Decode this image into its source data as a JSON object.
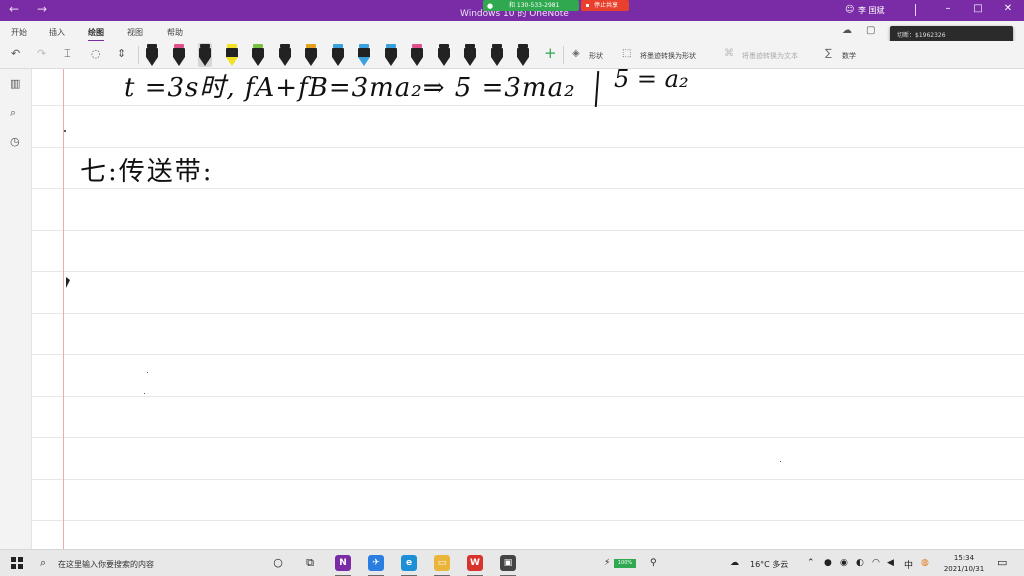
{
  "titlebar": {
    "title": "Windows 10 的 OneNote",
    "share_phone": "和 130-533-2981",
    "stop_share": "停止共享",
    "user": "李 国斌",
    "back_icon": "←",
    "forward_icon": "→"
  },
  "menu": {
    "tabs": [
      "开始",
      "插入",
      "绘图",
      "视图",
      "帮助"
    ],
    "active": "绘图"
  },
  "notification": {
    "text": "切断：$1962326"
  },
  "ribbon": {
    "shapes_label": "形状",
    "ink_to_shape": "将墨迹转换为形状",
    "ink_to_text": "将墨迹转换为文本",
    "math_label": "数学",
    "pens": [
      {
        "cap": "#222222",
        "tip": "#222222"
      },
      {
        "cap": "#e0508a",
        "tip": "#222222"
      },
      {
        "cap": "#222222",
        "tip": "#222222"
      },
      {
        "cap": "#f0e020",
        "tip": "#f0e020"
      },
      {
        "cap": "#7cc242",
        "tip": "#222222"
      },
      {
        "cap": "#222222",
        "tip": "#222222"
      },
      {
        "cap": "#e6a020",
        "tip": "#222222"
      },
      {
        "cap": "#3aa0e0",
        "tip": "#222222"
      },
      {
        "cap": "#3aa0e0",
        "tip": "#3aa0e0"
      },
      {
        "cap": "#3aa0e0",
        "tip": "#222222"
      },
      {
        "cap": "#e0508a",
        "tip": "#222222"
      },
      {
        "cap": "#222222",
        "tip": "#222222"
      },
      {
        "cap": "#222222",
        "tip": "#222222"
      },
      {
        "cap": "#222222",
        "tip": "#222222"
      },
      {
        "cap": "#222222",
        "tip": "#222222"
      }
    ]
  },
  "canvas": {
    "line1": "t =3s时, fA+fB=3ma₂⇒   5 =3ma₂",
    "line1_tail": "5 = a₂",
    "line2": "七:传送带:"
  },
  "taskbar": {
    "search_placeholder": "在这里输入你要搜索的内容",
    "battery": "100%",
    "weather": "16°C 多云",
    "ime": "中",
    "time": "15:34",
    "date": "2021/10/31",
    "apps": [
      {
        "name": "onenote",
        "label": "N",
        "color": "#7a2ca6"
      },
      {
        "name": "feishu",
        "label": "✈",
        "color": "#2a7de1"
      },
      {
        "name": "edge",
        "label": "e",
        "color": "#1d8fd6"
      },
      {
        "name": "explorer",
        "label": "▭",
        "color": "#e9b53b"
      },
      {
        "name": "wps",
        "label": "W",
        "color": "#d9342b"
      },
      {
        "name": "capture",
        "label": "▣",
        "color": "#444444"
      }
    ]
  }
}
